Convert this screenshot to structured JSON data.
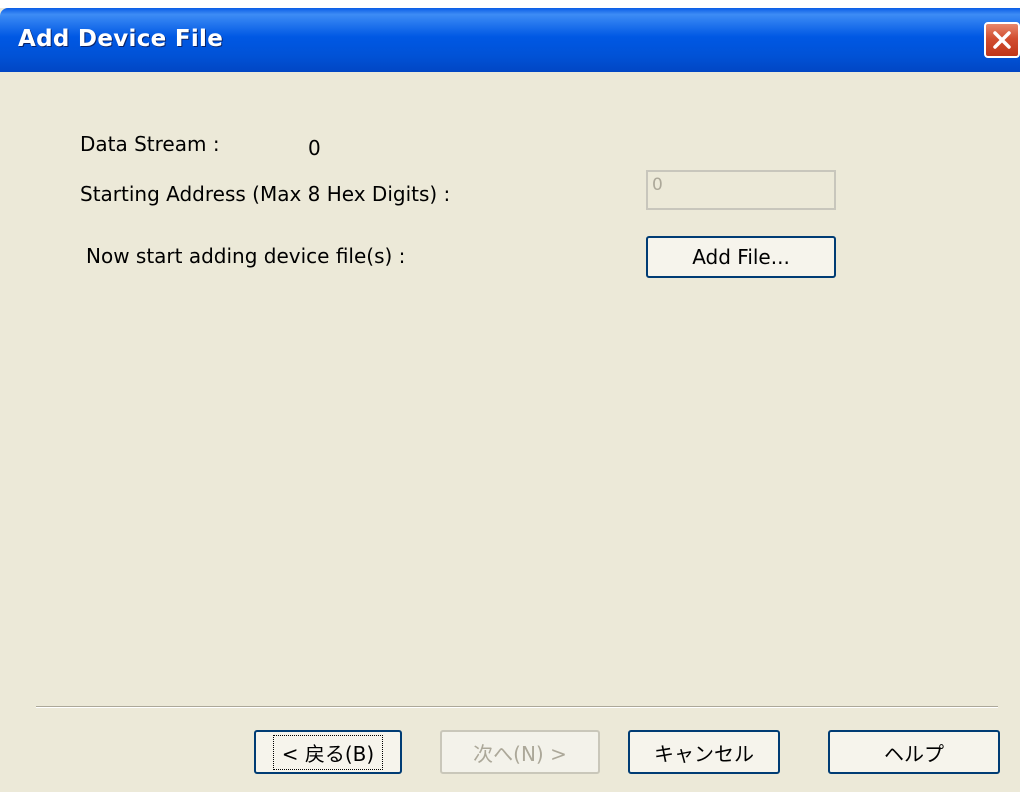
{
  "window": {
    "title": "Add Device File"
  },
  "form": {
    "data_stream_label": "Data Stream :",
    "data_stream_value": "0",
    "start_address_label": "Starting Address (Max 8 Hex Digits) :",
    "start_address_value": "0",
    "add_files_label": "Now start adding device file(s) :",
    "add_file_button": "Add File..."
  },
  "buttons": {
    "back": "< 戻る(B)",
    "next": "次へ(N) >",
    "cancel": "キャンセル",
    "help": "ヘルプ"
  },
  "icons": {
    "close": "close-icon"
  },
  "colors": {
    "titlebar": "#0058e4",
    "dialog_bg": "#ece9d8",
    "close_button": "#d24e30"
  }
}
